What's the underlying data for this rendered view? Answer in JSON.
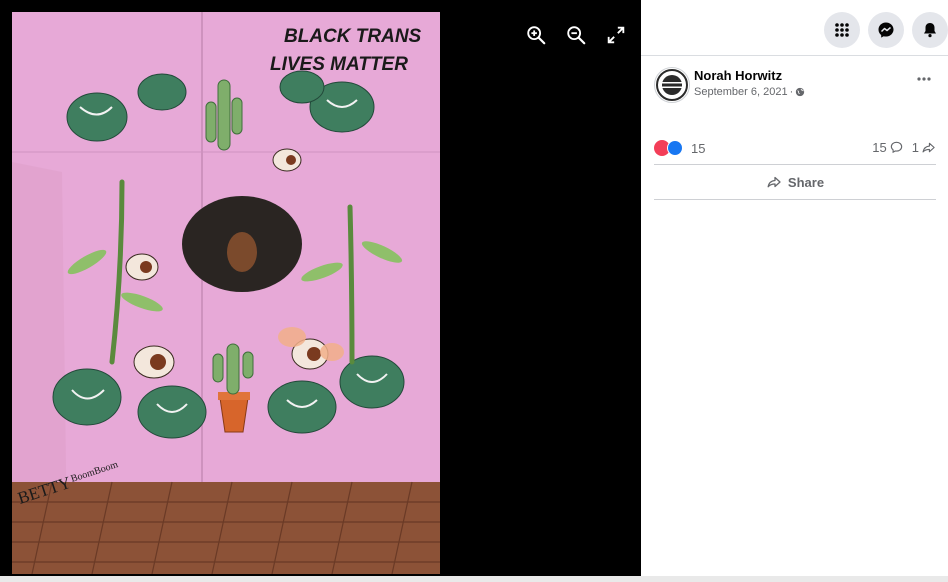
{
  "viewer": {
    "controls": [
      {
        "icon": "zoom-in-icon"
      },
      {
        "icon": "zoom-out-icon"
      },
      {
        "icon": "fullscreen-icon"
      }
    ],
    "mural": {
      "headline_line1": "BLACK TRANS",
      "headline_line2": "LIVES MATTER",
      "signature_part1": "BETTY",
      "signature_part2": "BoomBoom"
    }
  },
  "topbar": {
    "buttons": [
      {
        "icon": "menu-grid-icon"
      },
      {
        "icon": "messenger-icon"
      },
      {
        "icon": "notifications-bell-icon"
      }
    ]
  },
  "post": {
    "author": "Norah Horwitz",
    "date": "September 6, 2021",
    "separator": "·",
    "privacy_icon": "globe-icon",
    "more_icon": "more-options-icon",
    "reactions": {
      "icons": [
        "love-reaction-icon",
        "like-reaction-icon"
      ],
      "count": "15"
    },
    "comments_count": "15",
    "shares_count": "1",
    "share_label": "Share"
  },
  "colors": {
    "mural_pink": "#e4a8d6",
    "brick": "#8a4f38",
    "love_red": "#f33e58",
    "like_blue": "#1877f2",
    "muted_text": "#65676b"
  }
}
